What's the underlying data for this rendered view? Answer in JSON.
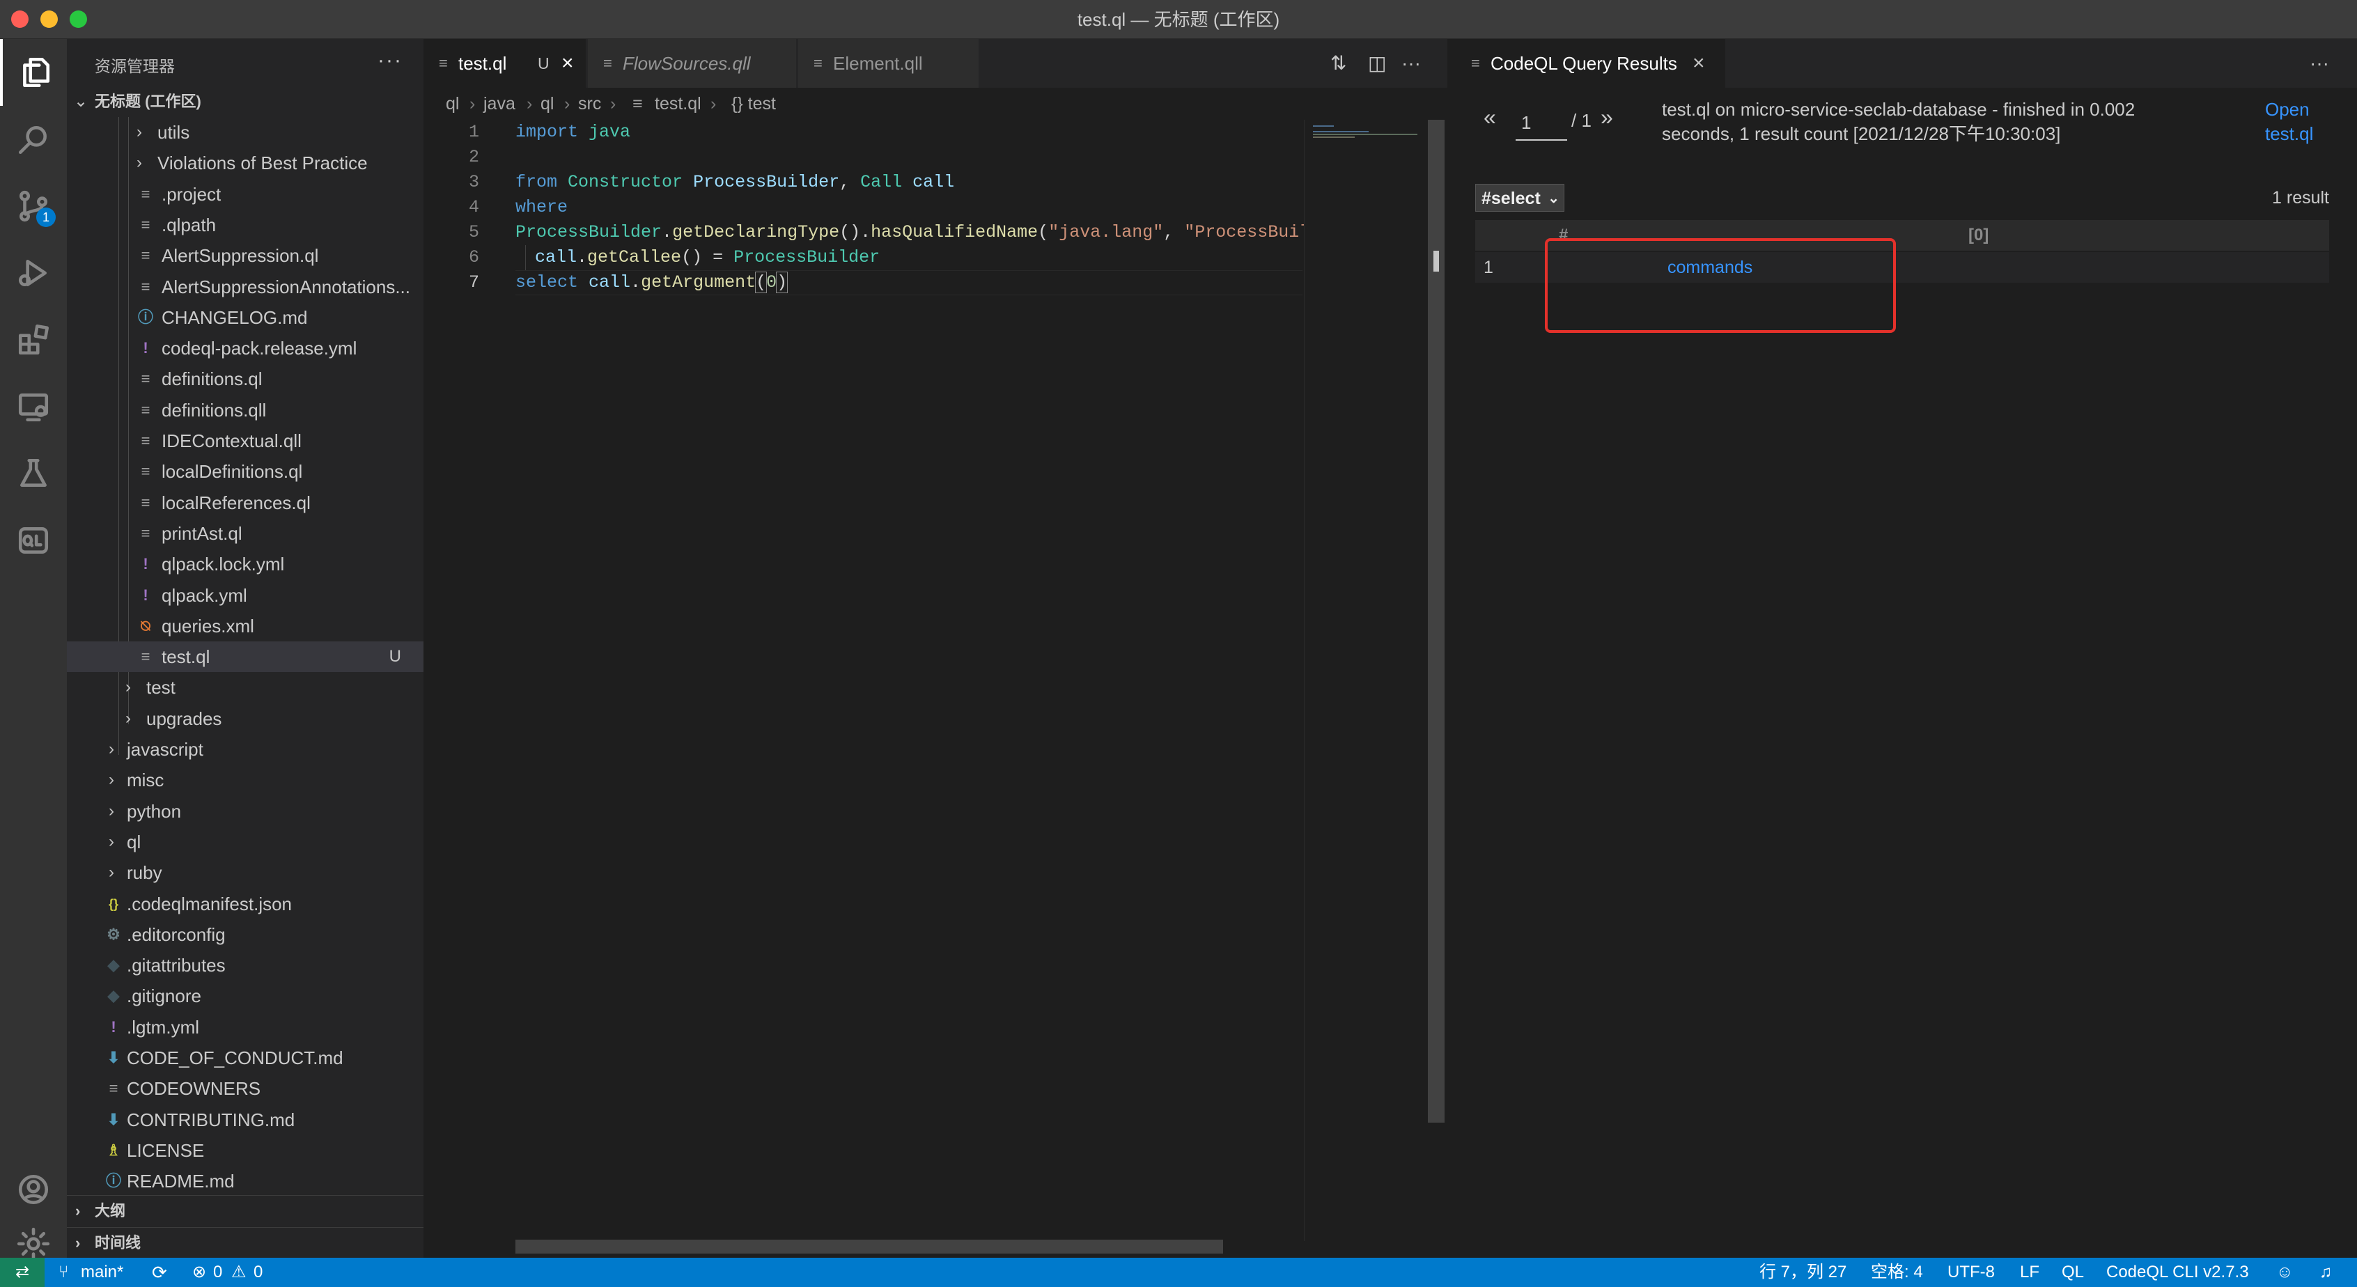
{
  "window": {
    "title": "test.ql — 无标题 (工作区)"
  },
  "activity_bar": {
    "scm_badge": "1"
  },
  "sidebar": {
    "header": "资源管理器",
    "more": "···",
    "workspace": "无标题 (工作区)",
    "items": [
      {
        "label": "utils",
        "type": "folder"
      },
      {
        "label": "Violations of Best Practice",
        "type": "folder"
      },
      {
        "label": ".project",
        "type": "file"
      },
      {
        "label": ".qlpath",
        "type": "file"
      },
      {
        "label": "AlertSuppression.ql",
        "type": "file"
      },
      {
        "label": "AlertSuppressionAnnotations...",
        "type": "file"
      },
      {
        "label": "CHANGELOG.md",
        "type": "info"
      },
      {
        "label": "codeql-pack.release.yml",
        "type": "yaml"
      },
      {
        "label": "definitions.ql",
        "type": "file"
      },
      {
        "label": "definitions.qll",
        "type": "file"
      },
      {
        "label": "IDEContextual.qll",
        "type": "file"
      },
      {
        "label": "localDefinitions.ql",
        "type": "file"
      },
      {
        "label": "localReferences.ql",
        "type": "file"
      },
      {
        "label": "printAst.ql",
        "type": "file"
      },
      {
        "label": "qlpack.lock.yml",
        "type": "yaml"
      },
      {
        "label": "qlpack.yml",
        "type": "yaml"
      },
      {
        "label": "queries.xml",
        "type": "rss"
      },
      {
        "label": "test.ql",
        "type": "file",
        "modified": "U"
      },
      {
        "label": "test",
        "type": "folder"
      },
      {
        "label": "upgrades",
        "type": "folder"
      },
      {
        "label": "javascript",
        "type": "folder"
      },
      {
        "label": "misc",
        "type": "folder"
      },
      {
        "label": "python",
        "type": "folder"
      },
      {
        "label": "ql",
        "type": "folder"
      },
      {
        "label": "ruby",
        "type": "folder"
      },
      {
        "label": ".codeqlmanifest.json",
        "type": "json"
      },
      {
        "label": ".editorconfig",
        "type": "gear"
      },
      {
        "label": ".gitattributes",
        "type": "git"
      },
      {
        "label": ".gitignore",
        "type": "git"
      },
      {
        "label": ".lgtm.yml",
        "type": "yaml"
      },
      {
        "label": "CODE_OF_CONDUCT.md",
        "type": "md"
      },
      {
        "label": "CODEOWNERS",
        "type": "file"
      },
      {
        "label": "CONTRIBUTING.md",
        "type": "md"
      },
      {
        "label": "LICENSE",
        "type": "license"
      },
      {
        "label": "README.md",
        "type": "info"
      }
    ],
    "sections": [
      "大纲",
      "时间线"
    ]
  },
  "editor": {
    "tabs": [
      {
        "label": "test.ql",
        "modified": "U",
        "close": "×"
      },
      {
        "label": "FlowSources.qll"
      },
      {
        "label": "Element.qll"
      }
    ],
    "breadcrumbs": [
      "ql",
      "java",
      "ql",
      "src",
      "test.ql",
      "{} test"
    ],
    "line_numbers": [
      "1",
      "2",
      "3",
      "4",
      "5",
      "6",
      "7"
    ]
  },
  "results": {
    "tab_label": "CodeQL Query Results",
    "tab_close": "×",
    "more": "···",
    "prev": "«",
    "next": "»",
    "page_value": "1",
    "page_total": "/ 1",
    "info_line1": "test.ql on micro-service-seclab-database - finished in 0.002",
    "info_line2": "seconds, 1 result count [2021/12/28下午10:30:03]",
    "open_line1": "Open",
    "open_line2": "test.ql",
    "select_value": "#select",
    "result_count": "1 result",
    "columns": [
      "#",
      "[0]"
    ],
    "rows": [
      {
        "index": "1",
        "value": "commands"
      }
    ],
    "highlight_color": "#e4312b"
  },
  "status_bar": {
    "branch": "main*",
    "errors": "0",
    "warnings": "0",
    "position": "行 7，列 27",
    "spaces": "空格: 4",
    "encoding": "UTF-8",
    "eol": "LF",
    "language": "QL",
    "cli": "CodeQL CLI v2.7.3"
  },
  "colors": {
    "accent": "#007acc",
    "link": "#3794ff",
    "remote": "#16825d"
  }
}
